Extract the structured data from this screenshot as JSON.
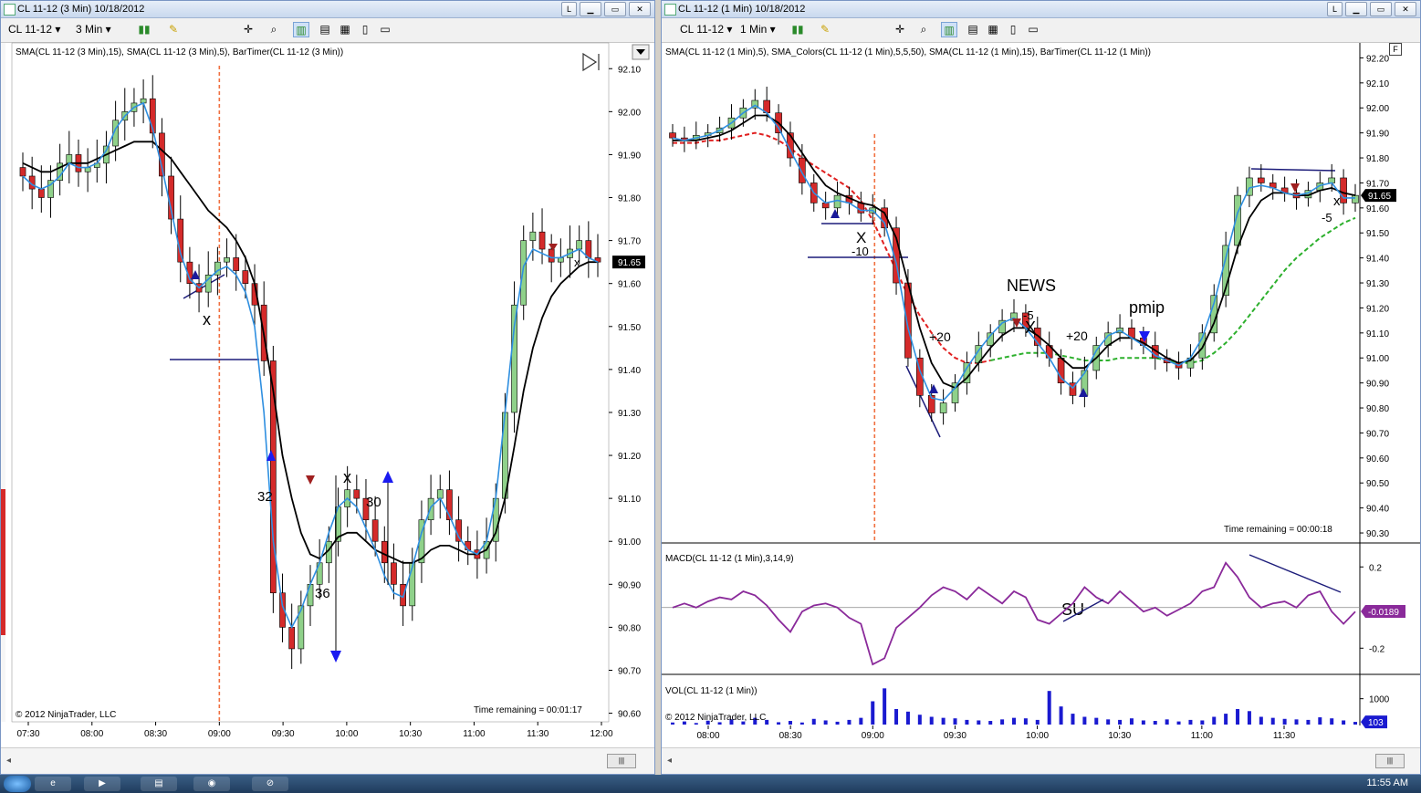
{
  "left_window": {
    "title": "CL 11-12 (3 Min)  10/18/2012",
    "instrument": "CL 11-12",
    "period": "3 Min",
    "indicator_label": "SMA(CL 11-12 (3 Min),15), SMA(CL 11-12 (3 Min),5), BarTimer(CL 11-12 (3 Min))",
    "time_remaining": "Time remaining = 00:01:17",
    "copyright": "© 2012 NinjaTrader, LLC",
    "btn_l": "L",
    "annotations": [
      "x",
      "x",
      "x",
      "32",
      "30",
      "36"
    ]
  },
  "right_window": {
    "title": "CL 11-12 (1 Min)  10/18/2012",
    "instrument": "CL 11-12",
    "period": "1 Min",
    "indicator_label": "SMA(CL 11-12 (1 Min),5), SMA_Colors(CL 11-12 (1 Min),5,5,50), SMA(CL 11-12 (1 Min),15), BarTimer(CL 11-12 (1 Min))",
    "time_remaining": "Time remaining = 00:00:18",
    "copyright": "© 2012 NinjaTrader, LLC",
    "macd_label": "MACD(CL 11-12 (1 Min),3,14,9)",
    "vol_label": "VOL(CL 11-12 (1 Min))",
    "btn_l": "L",
    "btn_f": "F",
    "annotations": [
      "NEWS",
      "pmip",
      "+20",
      "+20",
      "-5",
      "-5",
      "-10",
      "X",
      "X",
      "x",
      "SU"
    ]
  },
  "taskbar": {
    "clock": "11:55 AM"
  },
  "colors": {
    "up": "#8fd18a",
    "down": "#d42a2a",
    "sma_fast": "#2f8fe0",
    "sma_slow": "#000000",
    "macd": "#8a2a9a",
    "volume": "#1a1ad0",
    "dashed_red": "#e02020",
    "dashed_green": "#2db02d",
    "session_line": "#f07040"
  },
  "chart_data": [
    {
      "type": "candlestick",
      "title": "CL 11-12 (3 Min)",
      "ylim": [
        90.58,
        92.16
      ],
      "y_ticks": [
        "92.10",
        "92.00",
        "91.90",
        "91.80",
        "91.70",
        "91.60",
        "91.50",
        "91.40",
        "91.30",
        "91.20",
        "91.10",
        "91.00",
        "90.90",
        "90.80",
        "90.70",
        "90.60"
      ],
      "x_ticks": [
        "07:30",
        "08:00",
        "08:30",
        "09:00",
        "09:30",
        "10:00",
        "10:30",
        "11:00",
        "11:30",
        "12:00"
      ],
      "last_price": "91.65",
      "price_series": [
        91.85,
        91.82,
        91.8,
        91.84,
        91.88,
        91.9,
        91.86,
        91.87,
        91.88,
        91.92,
        91.98,
        92.0,
        92.02,
        92.03,
        91.95,
        91.85,
        91.75,
        91.65,
        91.6,
        91.58,
        91.62,
        91.65,
        91.66,
        91.63,
        91.6,
        91.55,
        91.42,
        90.88,
        90.8,
        90.75,
        90.85,
        90.9,
        90.95,
        91.0,
        91.08,
        91.12,
        91.1,
        91.05,
        91.0,
        90.95,
        90.9,
        90.85,
        90.95,
        91.05,
        91.1,
        91.12,
        91.05,
        91.0,
        90.98,
        90.96,
        91.0,
        91.1,
        91.3,
        91.55,
        91.7,
        91.72,
        91.68,
        91.65,
        91.66,
        91.68,
        91.7,
        91.66,
        91.65
      ],
      "series": [
        {
          "name": "SMA 15",
          "values": [
            91.88,
            91.87,
            91.86,
            91.86,
            91.87,
            91.88,
            91.88,
            91.88,
            91.89,
            91.9,
            91.91,
            91.92,
            91.93,
            91.93,
            91.93,
            91.91,
            91.89,
            91.86,
            91.83,
            91.8,
            91.77,
            91.75,
            91.73,
            91.7,
            91.66,
            91.6,
            91.48,
            91.35,
            91.2,
            91.1,
            91.02,
            90.97,
            90.96,
            90.98,
            91.01,
            91.02,
            91.02,
            91.0,
            90.98,
            90.97,
            90.96,
            90.95,
            90.95,
            90.96,
            90.98,
            90.99,
            90.99,
            90.98,
            90.97,
            90.97,
            90.98,
            91.02,
            91.1,
            91.22,
            91.35,
            91.45,
            91.52,
            91.57,
            91.6,
            91.62,
            91.64,
            91.65,
            91.65
          ]
        },
        {
          "name": "SMA 5",
          "values": [
            91.85,
            91.83,
            91.82,
            91.83,
            91.85,
            91.88,
            91.87,
            91.87,
            91.88,
            91.91,
            91.96,
            91.99,
            92.01,
            92.02,
            91.96,
            91.87,
            91.77,
            91.67,
            91.61,
            91.59,
            91.61,
            91.63,
            91.64,
            91.62,
            91.58,
            91.5,
            91.3,
            91.0,
            90.85,
            90.8,
            90.84,
            90.9,
            90.95,
            91.02,
            91.08,
            91.1,
            91.08,
            91.03,
            90.98,
            90.92,
            90.88,
            90.87,
            90.94,
            91.02,
            91.08,
            91.1,
            91.06,
            91.01,
            90.98,
            90.97,
            91.0,
            91.1,
            91.3,
            91.5,
            91.64,
            91.68,
            91.67,
            91.66,
            91.66,
            91.67,
            91.68,
            91.66,
            91.65
          ]
        }
      ]
    },
    {
      "type": "candlestick",
      "title": "CL 11-12 (1 Min)",
      "ylim": [
        90.26,
        92.26
      ],
      "y_ticks": [
        "92.20",
        "92.10",
        "92.00",
        "91.90",
        "91.80",
        "91.70",
        "91.60",
        "91.50",
        "91.40",
        "91.30",
        "91.20",
        "91.10",
        "91.00",
        "90.90",
        "90.80",
        "90.70",
        "90.60",
        "90.50",
        "90.40",
        "90.30"
      ],
      "x_ticks": [
        "08:00",
        "08:30",
        "09:00",
        "09:30",
        "10:00",
        "10:30",
        "11:00",
        "11:30"
      ],
      "last_price": "91.65",
      "price_series": [
        91.88,
        91.87,
        91.89,
        91.9,
        91.92,
        91.96,
        92.0,
        92.03,
        91.98,
        91.9,
        91.8,
        91.7,
        91.62,
        91.6,
        91.65,
        91.62,
        91.58,
        91.6,
        91.52,
        91.3,
        91.0,
        90.85,
        90.78,
        90.82,
        90.9,
        90.98,
        91.05,
        91.1,
        91.15,
        91.18,
        91.12,
        91.05,
        91.0,
        90.9,
        90.85,
        90.95,
        91.05,
        91.1,
        91.12,
        91.08,
        91.05,
        91.0,
        90.98,
        90.96,
        91.0,
        91.1,
        91.25,
        91.45,
        91.65,
        91.72,
        91.7,
        91.68,
        91.66,
        91.64,
        91.67,
        91.7,
        91.72,
        91.62,
        91.65
      ],
      "series": [
        {
          "name": "SMA 5",
          "values": [
            91.88,
            91.87,
            91.88,
            91.89,
            91.91,
            91.94,
            91.98,
            92.01,
            91.98,
            91.92,
            91.83,
            91.74,
            91.66,
            91.62,
            91.63,
            91.62,
            91.59,
            91.59,
            91.54,
            91.38,
            91.12,
            90.95,
            90.84,
            90.83,
            90.88,
            90.96,
            91.03,
            91.09,
            91.14,
            91.16,
            91.12,
            91.06,
            91.0,
            90.92,
            90.88,
            90.94,
            91.03,
            91.09,
            91.11,
            91.08,
            91.05,
            91.01,
            90.99,
            90.97,
            91.0,
            91.08,
            91.22,
            91.4,
            91.58,
            91.68,
            91.69,
            91.68,
            91.66,
            91.65,
            91.66,
            91.69,
            91.7,
            91.64,
            91.64
          ]
        },
        {
          "name": "SMA 15",
          "values": [
            91.87,
            91.87,
            91.87,
            91.88,
            91.89,
            91.91,
            91.94,
            91.97,
            91.97,
            91.94,
            91.89,
            91.82,
            91.75,
            91.69,
            91.66,
            91.64,
            91.62,
            91.61,
            91.58,
            91.48,
            91.3,
            91.12,
            90.98,
            90.9,
            90.88,
            90.92,
            90.98,
            91.04,
            91.09,
            91.12,
            91.12,
            91.09,
            91.05,
            91.0,
            90.96,
            90.96,
            91.0,
            91.05,
            91.08,
            91.08,
            91.06,
            91.03,
            91.0,
            90.98,
            90.99,
            91.04,
            91.14,
            91.28,
            91.44,
            91.56,
            91.63,
            91.66,
            91.66,
            91.65,
            91.65,
            91.67,
            91.68,
            91.66,
            91.65
          ]
        },
        {
          "name": "SMA_Colors 50",
          "values": [
            91.86,
            91.86,
            91.86,
            91.87,
            91.87,
            91.88,
            91.89,
            91.9,
            91.89,
            91.87,
            91.84,
            91.8,
            91.77,
            91.74,
            91.71,
            91.68,
            91.63,
            91.55,
            91.45,
            91.35,
            91.25,
            91.17,
            91.1,
            91.04,
            91.0,
            90.98,
            90.98,
            90.99,
            91.0,
            91.01,
            91.02,
            91.02,
            91.02,
            91.01,
            91.0,
            90.99,
            90.99,
            90.99,
            91.0,
            91.0,
            91.0,
            91.0,
            90.99,
            90.98,
            90.98,
            90.99,
            91.02,
            91.06,
            91.11,
            91.17,
            91.23,
            91.29,
            91.35,
            91.4,
            91.44,
            91.48,
            91.51,
            91.54,
            91.56
          ]
        }
      ],
      "macd": {
        "label": "MACD(CL 11-12 (1 Min),3,14,9)",
        "y_ticks": [
          "0.2",
          "-0.2"
        ],
        "ylim": [
          -0.32,
          0.3
        ],
        "last_value": "-0.0189",
        "values": [
          0.0,
          0.02,
          0.0,
          0.03,
          0.05,
          0.04,
          0.08,
          0.06,
          0.01,
          -0.06,
          -0.12,
          -0.02,
          0.01,
          0.02,
          0.0,
          -0.05,
          -0.08,
          -0.28,
          -0.25,
          -0.1,
          -0.05,
          0.0,
          0.06,
          0.1,
          0.08,
          0.04,
          0.1,
          0.06,
          0.02,
          0.08,
          0.05,
          -0.06,
          -0.08,
          -0.03,
          0.02,
          0.1,
          0.05,
          0.02,
          0.08,
          0.03,
          -0.02,
          0.0,
          -0.04,
          -0.01,
          0.02,
          0.08,
          0.1,
          0.22,
          0.15,
          0.05,
          0.0,
          0.02,
          0.03,
          0.0,
          0.06,
          0.08,
          -0.02,
          -0.08,
          -0.02
        ]
      },
      "volume": {
        "label": "VOL(CL 11-12 (1 Min))",
        "y_ticks": [
          "1000"
        ],
        "ymax": 1800,
        "last_value": "103",
        "values": [
          80,
          120,
          60,
          150,
          90,
          200,
          120,
          260,
          180,
          90,
          140,
          80,
          220,
          160,
          110,
          180,
          260,
          900,
          1400,
          600,
          500,
          380,
          300,
          260,
          240,
          180,
          160,
          140,
          200,
          260,
          240,
          180,
          1300,
          700,
          420,
          300,
          260,
          200,
          180,
          240,
          160,
          140,
          200,
          120,
          180,
          160,
          300,
          420,
          600,
          520,
          300,
          260,
          220,
          200,
          180,
          280,
          240,
          160,
          103
        ]
      }
    }
  ]
}
